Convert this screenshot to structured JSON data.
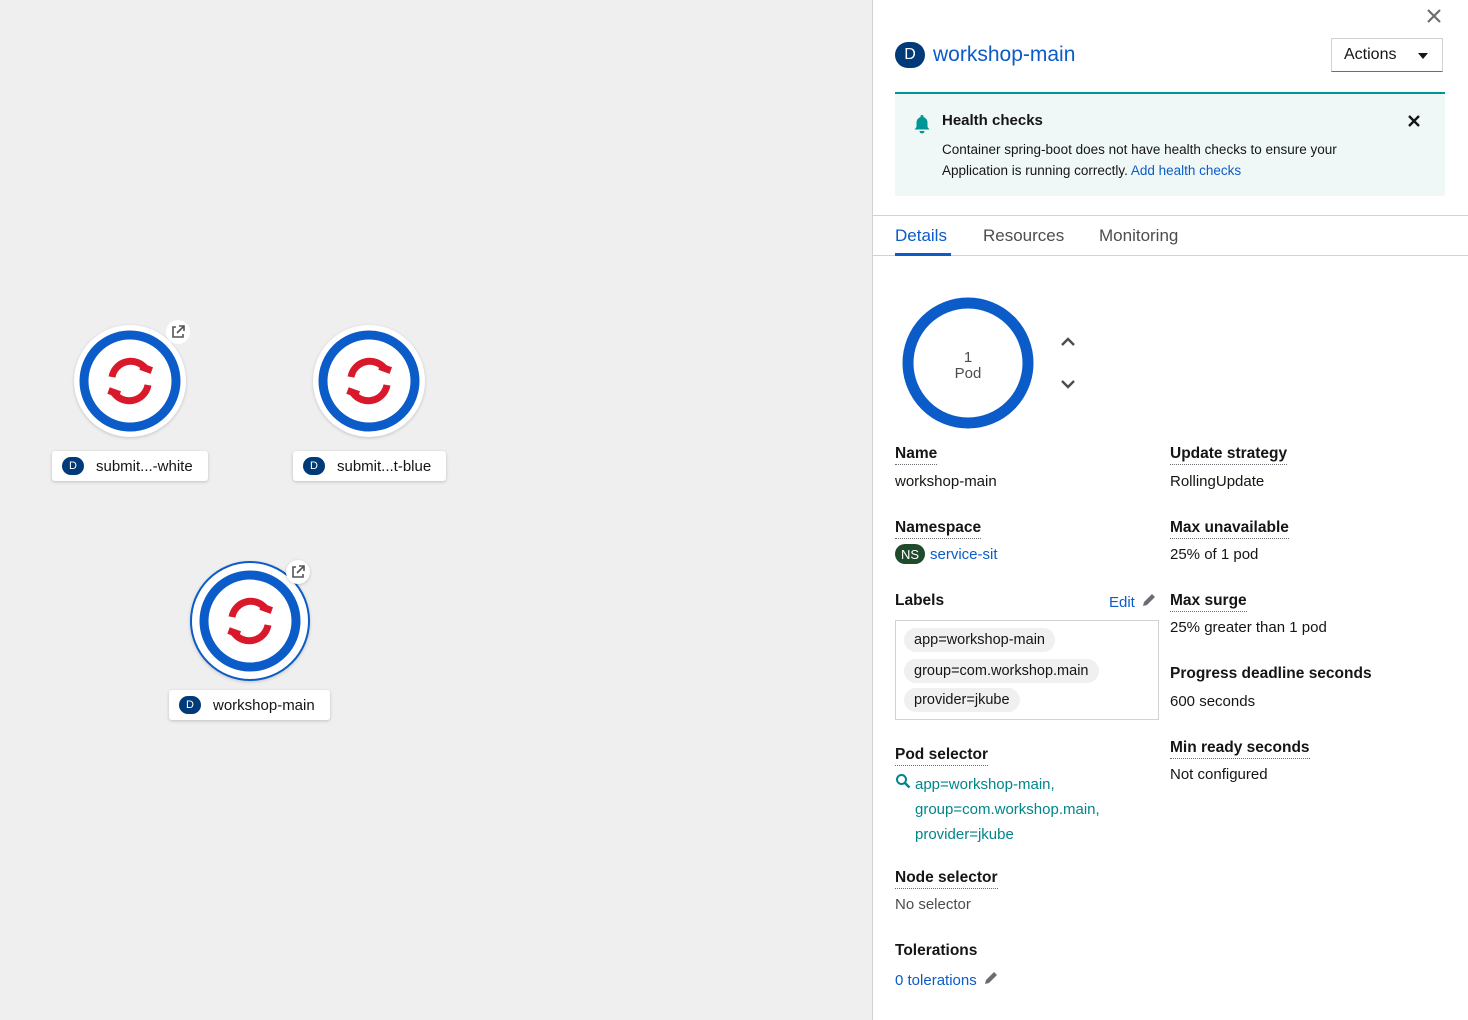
{
  "topology": {
    "nodes": [
      {
        "badge": "D",
        "label": "submit...-white",
        "has_external_link": true,
        "selected": false
      },
      {
        "badge": "D",
        "label": "submit...t-blue",
        "has_external_link": false,
        "selected": false
      },
      {
        "badge": "D",
        "label": "workshop-main",
        "has_external_link": true,
        "selected": true
      }
    ]
  },
  "panel": {
    "resource_badge": "D",
    "title": "workshop-main",
    "actions_label": "Actions",
    "alert": {
      "title": "Health checks",
      "body": "Container spring-boot does not have health checks to ensure your Application is running correctly.",
      "link": "Add health checks"
    },
    "tabs": [
      {
        "label": "Details",
        "active": true
      },
      {
        "label": "Resources",
        "active": false
      },
      {
        "label": "Monitoring",
        "active": false
      }
    ],
    "pod_ring": {
      "count": "1",
      "unit": "Pod"
    },
    "details": {
      "name_label": "Name",
      "name_value": "workshop-main",
      "namespace_label": "Namespace",
      "namespace_badge": "NS",
      "namespace_value": "service-sit",
      "labels_label": "Labels",
      "labels_edit": "Edit",
      "labels": [
        "app=workshop-main",
        "group=com.workshop.main",
        "provider=jkube"
      ],
      "pod_selector_label": "Pod selector",
      "pod_selector_lines": [
        "app=workshop-main,",
        "group=com.workshop.main,",
        "provider=jkube"
      ],
      "node_selector_label": "Node selector",
      "node_selector_value": "No selector",
      "tolerations_label": "Tolerations",
      "tolerations_value": "0 tolerations",
      "update_strategy_label": "Update strategy",
      "update_strategy_value": "RollingUpdate",
      "max_unavailable_label": "Max unavailable",
      "max_unavailable_value": "25% of 1 pod",
      "max_surge_label": "Max surge",
      "max_surge_value": "25% greater than 1 pod",
      "progress_deadline_label": "Progress deadline seconds",
      "progress_deadline_value": "600 seconds",
      "min_ready_label": "Min ready seconds",
      "min_ready_value": "Not configured"
    }
  },
  "colors": {
    "accent": "#0b5bc8",
    "ring": "#0b5bc8",
    "logo_red": "#d9182b",
    "ns_badge": "#1f4b2c",
    "alert_bg": "#f0f8f7"
  }
}
